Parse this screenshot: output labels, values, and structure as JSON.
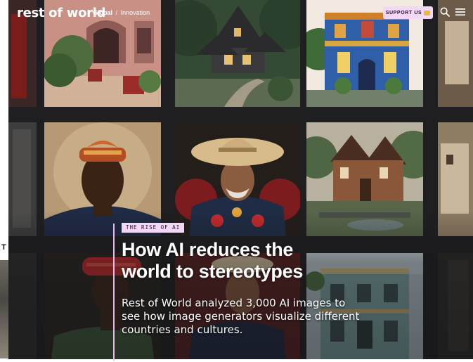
{
  "site": {
    "logo": "rest of world",
    "breadcrumb": {
      "section": "Global",
      "separator": "/",
      "subsection": "Innovation"
    },
    "support_label": "SUPPORT US",
    "icons": {
      "support": "coin-icon",
      "search": "search-icon",
      "menu": "hamburger-menu-icon"
    }
  },
  "story": {
    "kicker": "THE RISE OF AI",
    "headline_line1": "How AI reduces the",
    "headline_line2": "world to stereotypes",
    "dek": "Rest of World analyzed 3,000 AI images to see how image generators visualize different countries and cultures."
  },
  "colors": {
    "background": "#1f1f21",
    "accent_pink": "#f3d7f6",
    "accent_rule": "#e8b7ee",
    "text": "#ffffff"
  }
}
